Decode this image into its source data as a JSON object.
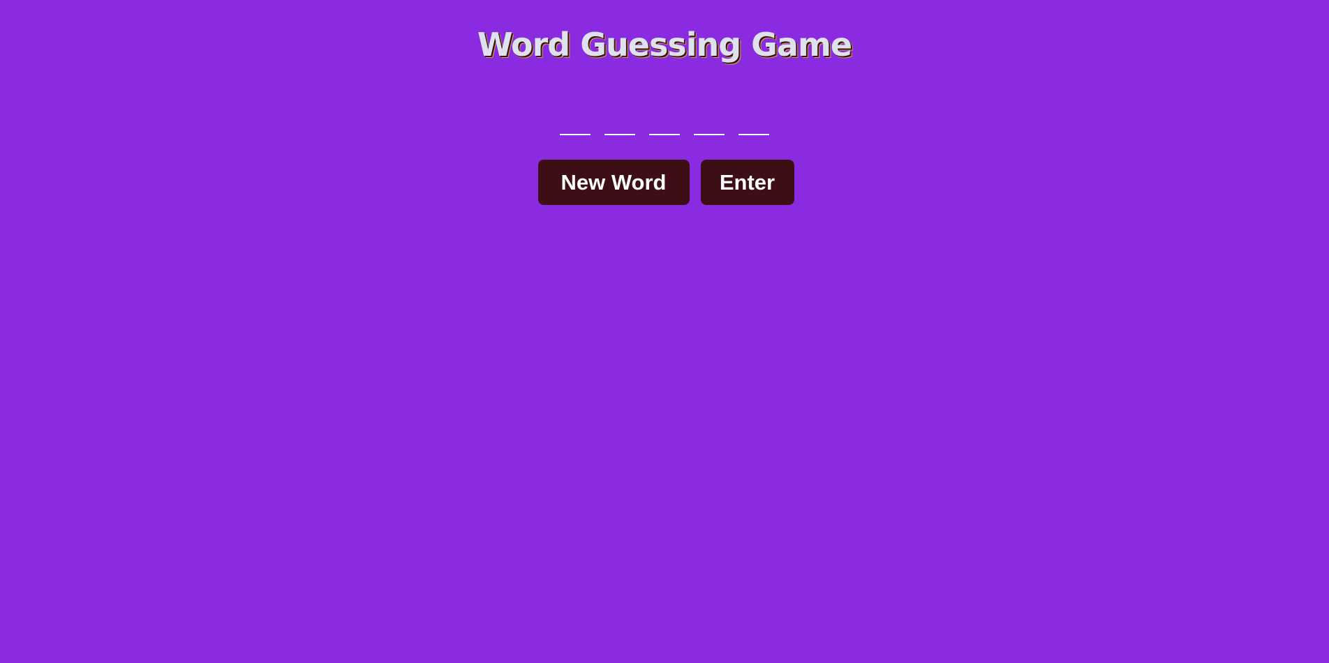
{
  "title": "Word Guessing Game",
  "word": {
    "letters": [
      "",
      "",
      "",
      "",
      ""
    ]
  },
  "buttons": {
    "new_word_label": "New Word",
    "enter_label": "Enter"
  },
  "colors": {
    "background": "#8a2be2",
    "button_background": "#3d0f14",
    "title_text": "#dde2ee",
    "button_text": "#ffffff"
  }
}
